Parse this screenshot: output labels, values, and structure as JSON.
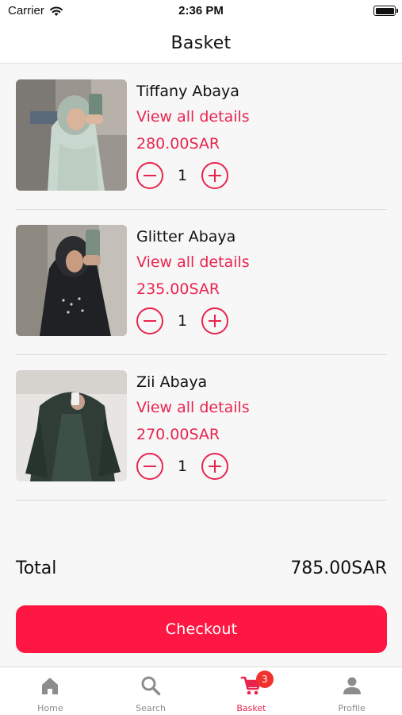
{
  "status_bar": {
    "carrier": "Carrier",
    "time": "2:36 PM"
  },
  "header": {
    "title": "Basket"
  },
  "items": [
    {
      "name": "Tiffany Abaya",
      "details_link": "View all details",
      "price": "280.00SAR",
      "quantity": "1"
    },
    {
      "name": "Glitter Abaya",
      "details_link": "View all details",
      "price": "235.00SAR",
      "quantity": "1"
    },
    {
      "name": "Zii Abaya",
      "details_link": "View all details",
      "price": "270.00SAR",
      "quantity": "1"
    }
  ],
  "summary": {
    "total_label": "Total",
    "total_value": "785.00SAR"
  },
  "checkout": {
    "label": "Checkout"
  },
  "tab_bar": {
    "tabs": [
      {
        "label": "Home",
        "icon": "home-icon"
      },
      {
        "label": "Search",
        "icon": "search-icon"
      },
      {
        "label": "Basket",
        "icon": "cart-icon",
        "badge": "3",
        "active": true
      },
      {
        "label": "Profile",
        "icon": "person-icon"
      }
    ]
  },
  "colors": {
    "accent": "#e8254f",
    "checkout": "#ff1744",
    "badge": "#f0312d",
    "inactive": "#8c8c8c"
  }
}
